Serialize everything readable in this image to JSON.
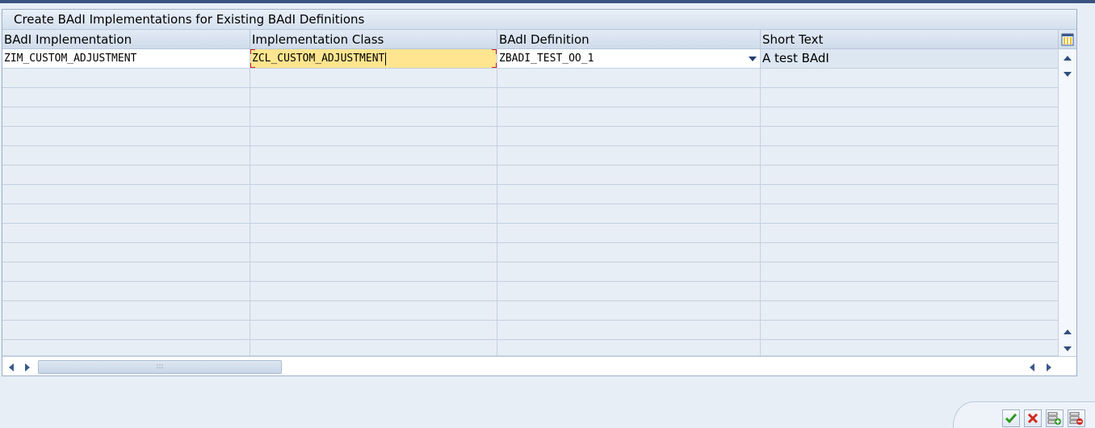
{
  "dialog": {
    "title": "Create BAdI Implementations for Existing BAdI Definitions"
  },
  "table": {
    "columns": [
      {
        "label": "BAdI Implementation"
      },
      {
        "label": "Implementation Class"
      },
      {
        "label": "BAdI Definition"
      },
      {
        "label": "Short Text"
      }
    ],
    "rows": [
      {
        "badi_implementation": "ZIM_CUSTOM_ADJUSTMENT",
        "implementation_class": "ZCL_CUSTOM_ADJUSTMENT",
        "badi_definition": "ZBADI_TEST_OO_1",
        "short_text": "A test BAdI"
      }
    ]
  },
  "icons": {
    "column_settings": "column-settings-icon",
    "confirm": "checkmark-icon",
    "cancel": "cancel-x-icon",
    "insert_row": "insert-row-icon",
    "delete_row": "delete-row-icon"
  },
  "colors": {
    "focus_cell": "#ffe58f",
    "confirm_green": "#2e9a1f",
    "cancel_red": "#d02a1e"
  }
}
